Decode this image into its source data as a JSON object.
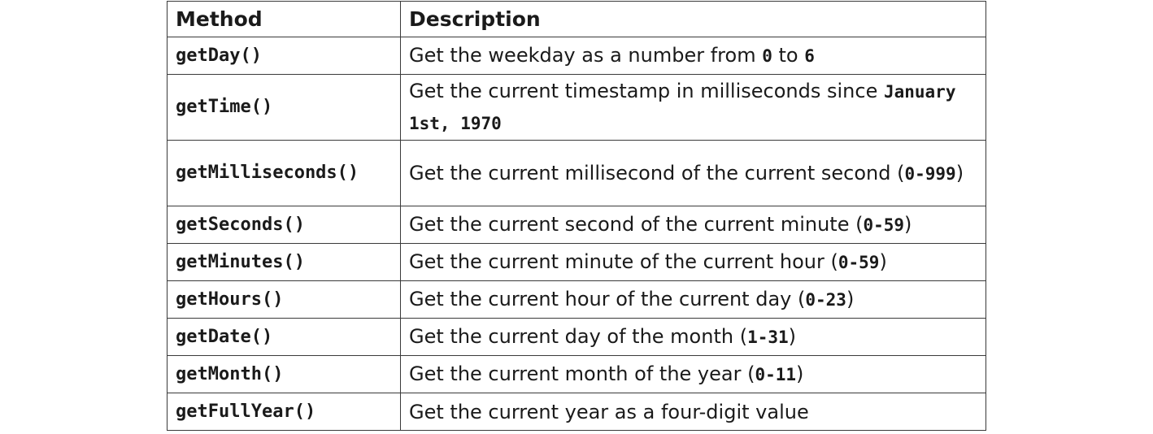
{
  "table": {
    "headers": {
      "method": "Method",
      "description": "Description"
    },
    "rows": [
      {
        "method": "getDay()",
        "desc": {
          "text1": "Get the weekday as a number from ",
          "code1": "0",
          "text2": " to ",
          "code2": "6"
        }
      },
      {
        "method": "getTime()",
        "desc": {
          "text1": "Get the current timestamp in milliseconds since ",
          "code1": "January 1st, 1970"
        }
      },
      {
        "method": "getMilliseconds()",
        "desc": {
          "text1": "Get the current millisecond of the current second (",
          "code1": "0-999",
          "text2": ")"
        }
      },
      {
        "method": "getSeconds()",
        "desc": {
          "text1": "Get the current second of the current minute (",
          "code1": "0-59",
          "text2": ")"
        }
      },
      {
        "method": "getMinutes()",
        "desc": {
          "text1": "Get the current minute of the current hour (",
          "code1": "0-59",
          "text2": ")"
        }
      },
      {
        "method": "getHours()",
        "desc": {
          "text1": "Get the current hour of the current day (",
          "code1": "0-23",
          "text2": ")"
        }
      },
      {
        "method": "getDate()",
        "desc": {
          "text1": "Get the current day of the month (",
          "code1": "1-31",
          "text2": ")"
        }
      },
      {
        "method": "getMonth()",
        "desc": {
          "text1": "Get the current month of the year (",
          "code1": "0-11",
          "text2": ")"
        }
      },
      {
        "method": "getFullYear()",
        "desc": {
          "text1": "Get the current year as a four-digit value"
        }
      }
    ]
  }
}
